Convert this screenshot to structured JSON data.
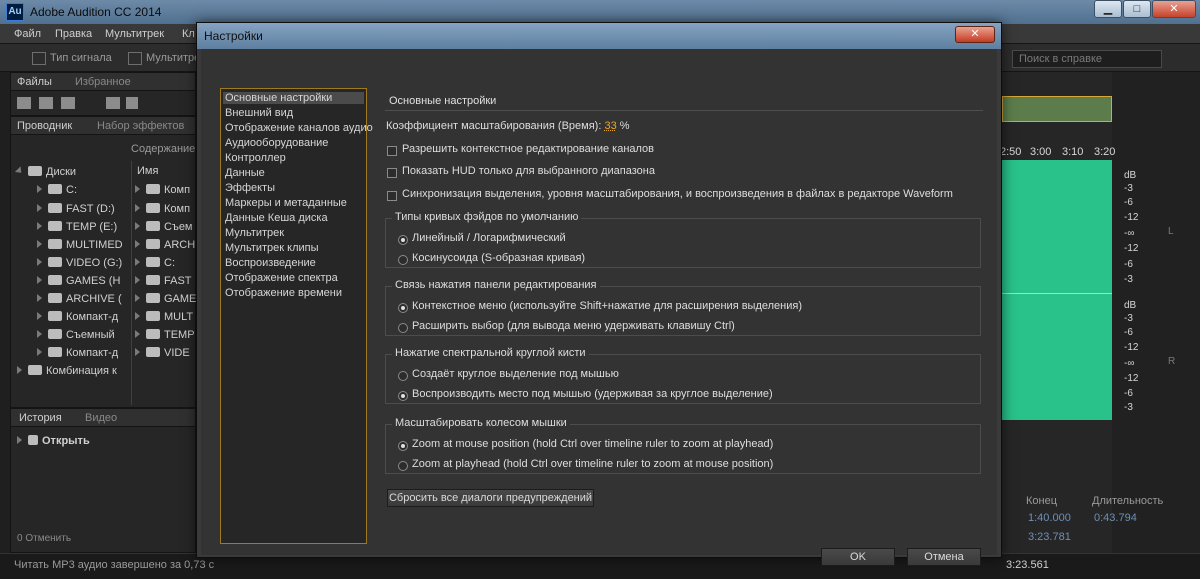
{
  "app": {
    "logo": "Au",
    "title": "Adobe Audition CC 2014"
  },
  "window_controls": {
    "minimize": "▁",
    "maximize": "□",
    "close": "✕"
  },
  "menu": [
    "Файл",
    "Правка",
    "Мультитрек",
    "Кл"
  ],
  "toolbar": {
    "btn1": "Тип сигнала",
    "btn2": "Мультитрек",
    "help_search": "Поиск в справке"
  },
  "left_top_panel": {
    "tabs": [
      "Файлы",
      "Избранное"
    ]
  },
  "browser_panel": {
    "tabs": [
      "Проводник",
      "Набор эффектов"
    ],
    "content_label": "Содержание:",
    "column_name": "Имя",
    "tree": [
      "Диски",
      "C:",
      "FAST (D:)",
      "TEMP (E:)",
      "MULTIMED",
      "VIDEO (G:)",
      "GAMES (H",
      "ARCHIVE (",
      "Компакт-д",
      "Съемный",
      "Компакт-д",
      "Комбинация к"
    ],
    "list": [
      "Комп",
      "Комп",
      "Съем",
      "ARCH",
      "C:",
      "FAST",
      "GAME",
      "MULT",
      "TEMP",
      "VIDE"
    ]
  },
  "history_panel": {
    "tabs": [
      "История",
      "Видео"
    ],
    "item": "Открыть",
    "undo_count": "0 Отменить"
  },
  "status": {
    "left": "Читать MP3 аудио завершено за 0,73 с",
    "bottom_right": "3:23.561",
    "bottom_right2": "3:23.781"
  },
  "timeline": {
    "ruler": [
      "2:50",
      "3:00",
      "3:10",
      "3:20"
    ],
    "db_upper": [
      "dB",
      "-3",
      "-6",
      "-12",
      "-∞",
      "-12",
      "-6",
      "-3"
    ],
    "db_lower": [
      "dB",
      "-3",
      "-6",
      "-12",
      "-∞",
      "-12",
      "-6",
      "-3"
    ],
    "channel_l": "L",
    "channel_r": "R"
  },
  "selection_panel": {
    "end_header": "Конец",
    "duration_header": "Длительность",
    "end_value": "1:40.000",
    "duration_value": "0:43.794"
  },
  "dialog": {
    "title": "Настройки",
    "close": "✕",
    "categories": [
      "Основные настройки",
      "Внешний вид",
      "Отображение каналов аудио",
      "Аудиооборудование",
      "Контроллер",
      "Данные",
      "Эффекты",
      "Маркеры и метаданные",
      "Данные Кеша диска",
      "Мультитрек",
      "Мультитрек клипы",
      "Воспроизведение",
      "Отображение спектра",
      "Отображение времени"
    ],
    "section_title": "Основные настройки",
    "zoom_label": "Коэффициент масштабирования (Время):",
    "zoom_value": "33",
    "zoom_unit": "%",
    "checkboxes": [
      "Разрешить контекстное редактирование каналов",
      "Показать HUD только для выбранного диапазона",
      "Синхронизация выделения, уровня масштабирования, и воспроизведения в файлах в редакторе Waveform"
    ],
    "fade_group": {
      "title": "Типы кривых фэйдов по умолчанию",
      "options": [
        "Линейный / Логарифмический",
        "Косинусоида (S-образная кривая)"
      ]
    },
    "click_group": {
      "title": "Связь нажатия панели редактирования",
      "options": [
        "Контекстное меню (используйте Shift+нажатие для расширения выделения)",
        "Расширить выбор (для вывода меню удерживать клавишу Ctrl)"
      ]
    },
    "brush_group": {
      "title": "Нажатие спектральной круглой кисти",
      "options": [
        "Создаёт круглое выделение под мышью",
        "Воспроизводить место под мышью (удерживая за круглое выделение)"
      ]
    },
    "wheel_group": {
      "title": "Масштабировать колесом мышки",
      "options": [
        "Zoom at mouse position (hold Ctrl over timeline ruler to zoom at playhead)",
        "Zoom at playhead (hold Ctrl over timeline ruler to zoom at mouse position)"
      ]
    },
    "reset_button": "Сбросить все диалоги предупреждений",
    "ok_button": "OK",
    "cancel_button": "Отмена"
  }
}
